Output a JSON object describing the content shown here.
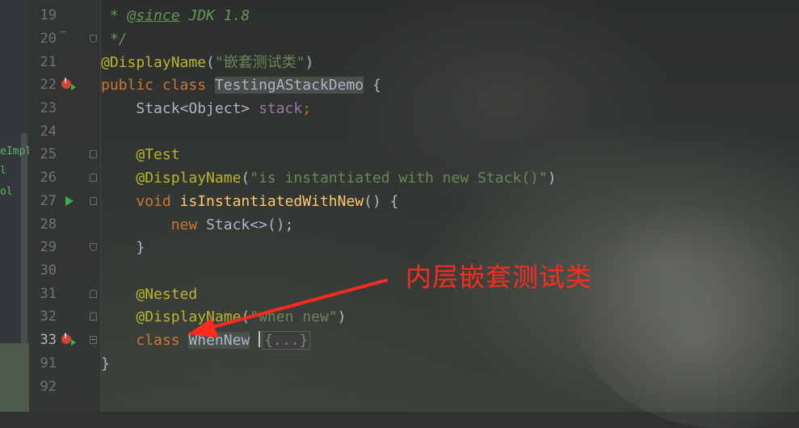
{
  "project_panel": {
    "items": [
      {
        "text": "eImpl"
      },
      {
        "text": "l"
      },
      {
        "text": "ol"
      }
    ]
  },
  "gutter": {
    "lines": [
      {
        "number": "19"
      },
      {
        "number": "20"
      },
      {
        "number": "21"
      },
      {
        "number": "22"
      },
      {
        "number": "23"
      },
      {
        "number": "24"
      },
      {
        "number": "25"
      },
      {
        "number": "26"
      },
      {
        "number": "27"
      },
      {
        "number": "28"
      },
      {
        "number": "29"
      },
      {
        "number": "30"
      },
      {
        "number": "31"
      },
      {
        "number": "32"
      },
      {
        "number": "33"
      },
      {
        "number": "91"
      },
      {
        "number": "92"
      }
    ]
  },
  "code": {
    "l19": {
      "prefix": " * ",
      "tag": "@since",
      "rest": " JDK 1.8"
    },
    "l20": {
      "text": " */"
    },
    "l21": {
      "anno": "@DisplayName",
      "open": "(",
      "str": "\"嵌套测试类\"",
      "close": ")"
    },
    "l22": {
      "kw": "public class ",
      "name": "TestingAStackDemo",
      "brace": " {"
    },
    "l23": {
      "indent": "    ",
      "type": "Stack<Object> ",
      "field": "stack",
      "semi": ";"
    },
    "l24": {
      "text": ""
    },
    "l25": {
      "indent": "    ",
      "anno": "@Test"
    },
    "l26": {
      "indent": "    ",
      "anno": "@DisplayName",
      "open": "(",
      "str": "\"is instantiated with new Stack()\"",
      "close": ")"
    },
    "l27": {
      "indent": "    ",
      "kw": "void ",
      "method": "isInstantiatedWithNew",
      "rest": "() {"
    },
    "l28": {
      "indent": "        ",
      "kw": "new ",
      "rest": "Stack<>();"
    },
    "l29": {
      "indent": "    ",
      "text": "}"
    },
    "l30": {
      "text": ""
    },
    "l31": {
      "indent": "    ",
      "anno": "@Nested"
    },
    "l32": {
      "indent": "    ",
      "anno": "@DisplayName",
      "open": "(",
      "str": "\"when new\"",
      "close": ")"
    },
    "l33": {
      "indent": "    ",
      "kw": "class ",
      "name": "WhenNew",
      "space": " ",
      "folded": "{...}"
    },
    "l91": {
      "text": "}"
    },
    "l92": {
      "text": ""
    }
  },
  "annotation": {
    "text": "内层嵌套测试类",
    "color": "#ff2a1e"
  }
}
